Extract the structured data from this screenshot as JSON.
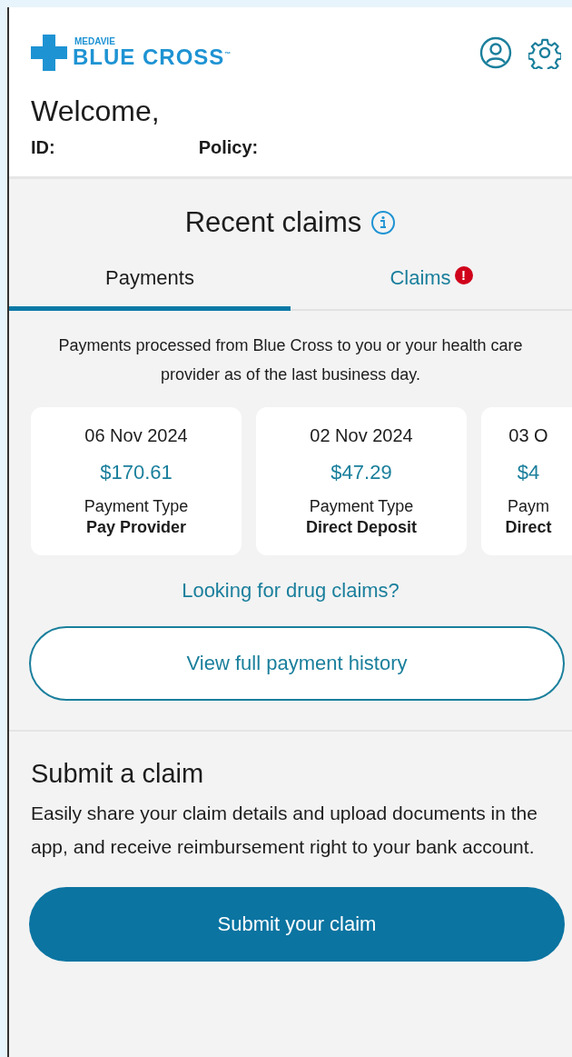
{
  "header": {
    "logo": {
      "small": "MEDAVIE",
      "main": "BLUE CROSS",
      "mark": "™"
    },
    "welcome": "Welcome,",
    "id_label": "ID:",
    "policy_label": "Policy:"
  },
  "recent_claims": {
    "title": "Recent claims",
    "tabs": [
      {
        "label": "Payments",
        "selected": true,
        "alert": false
      },
      {
        "label": "Claims",
        "selected": false,
        "alert": true,
        "alert_text": "!"
      }
    ],
    "description": "Payments processed from Blue Cross to you or your health care provider as of the last business day.",
    "payments": [
      {
        "date": "06 Nov 2024",
        "amount": "$170.61",
        "type_label": "Payment Type",
        "type": "Pay Provider",
        "cut": false
      },
      {
        "date": "02 Nov 2024",
        "amount": "$47.29",
        "type_label": "Payment Type",
        "type": "Direct Deposit",
        "cut": false
      },
      {
        "date": "03 O",
        "amount": "$4",
        "type_label": "Paym",
        "type": "Direct",
        "cut": true
      }
    ],
    "drug_link": "Looking for drug claims?",
    "history_button": "View full payment history"
  },
  "submit": {
    "title": "Submit a claim",
    "text": "Easily share your claim details and upload documents in the app, and receive reimbursement right to your bank account.",
    "button": "Submit your claim"
  }
}
